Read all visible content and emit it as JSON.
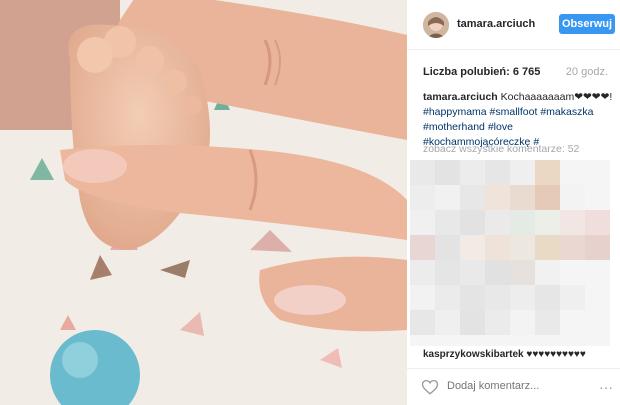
{
  "post": {
    "username": "tamara.arciuch",
    "follow_label": "Obserwuj",
    "likes": "Liczba polubień: 6 765",
    "time_ago": "20 godz.",
    "caption_user": "tamara.arciuch",
    "caption_text": "Kochaaaaaaam",
    "caption_hearts": "❤❤❤❤!",
    "hashtags_line1": [
      "#happymama",
      "#smallfoot",
      "#makaszka"
    ],
    "hashtags_line2": [
      "#motherhand",
      "#love"
    ],
    "hashtags_line3": [
      "#kochammojącóreczkę",
      "#"
    ],
    "all_comments": "zobacz wszystkie komentarze: 52",
    "comment_user": "kasprzykowskibartek",
    "comment_text": "♥♥♥♥♥♥♥♥♥♥",
    "add_comment_placeholder": "Dodaj komentarz...",
    "more_label": "···"
  },
  "colors": {
    "accent": "#3897f0",
    "hashtag": "#003569",
    "muted": "#a5a7aa"
  },
  "icons": {
    "like": "heart-outline-icon",
    "more": "more-options-icon"
  }
}
